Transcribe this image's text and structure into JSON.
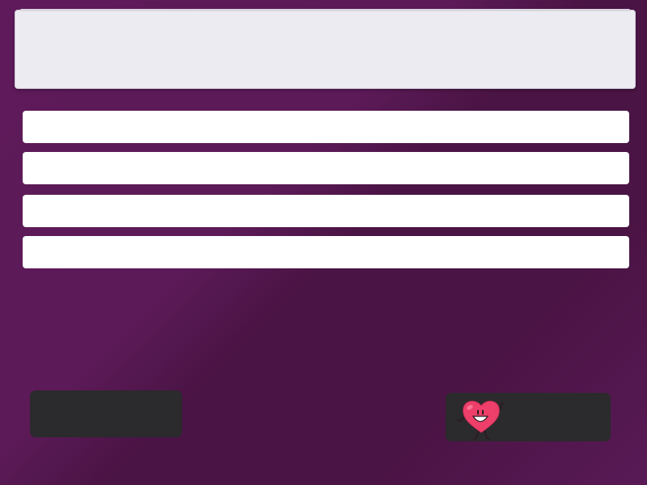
{
  "question": {
    "text": ""
  },
  "answers": [
    {
      "label": ""
    },
    {
      "label": ""
    },
    {
      "label": ""
    },
    {
      "label": ""
    }
  ],
  "buttons": {
    "left_label": "",
    "right_label": ""
  },
  "mascot": {
    "icon": "smiling-heart-icon",
    "color": "#ee3f6a"
  },
  "colors": {
    "background": "#5e1a5a",
    "panel": "#ecebf2",
    "answer": "#ffffff",
    "button": "#2b2a2c"
  }
}
